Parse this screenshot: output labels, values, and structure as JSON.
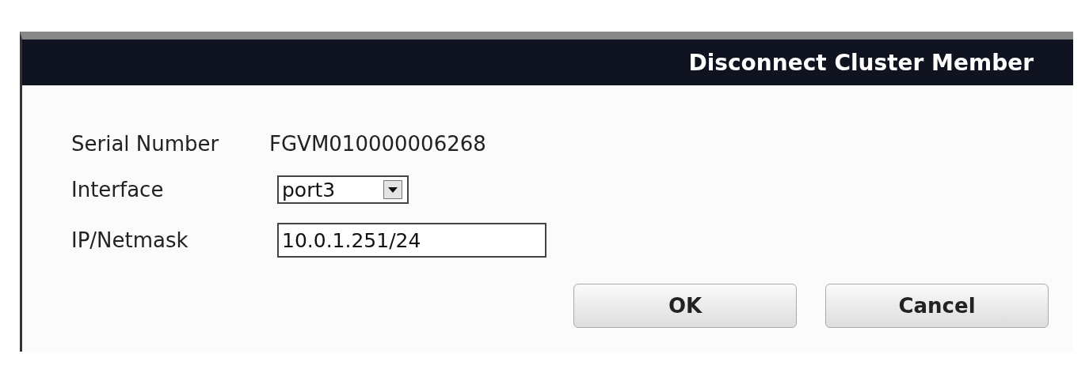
{
  "dialog": {
    "title": "Disconnect Cluster Member"
  },
  "fields": [
    {
      "kind": "text",
      "label": "Serial Number",
      "value": "FGVM010000006268"
    },
    {
      "kind": "select",
      "label": "Interface",
      "value": "port3"
    },
    {
      "kind": "input",
      "label": "IP/Netmask",
      "value": "10.0.1.251/24"
    }
  ],
  "buttons": [
    "OK",
    "Cancel"
  ]
}
